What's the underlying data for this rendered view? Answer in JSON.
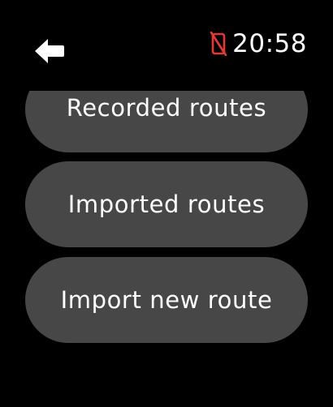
{
  "status_bar": {
    "back_icon": "arrow-left-icon",
    "connection_icon": "phone-disconnected-icon",
    "connection_color": "#e53935",
    "time": "20:58"
  },
  "menu": {
    "items": [
      {
        "label": "Recorded routes"
      },
      {
        "label": "Imported routes"
      },
      {
        "label": "Import new route"
      }
    ],
    "button_color": "#474747"
  }
}
